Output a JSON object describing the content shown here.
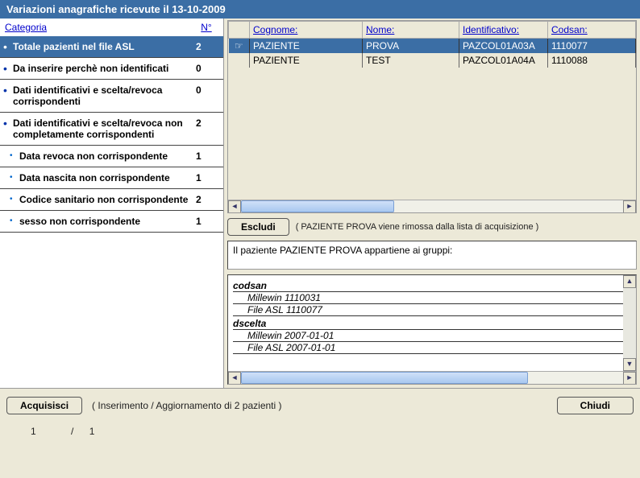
{
  "title": "Variazioni anagrafiche ricevute il 13-10-2009",
  "left": {
    "header_cat": "Categoria",
    "header_num": "N°",
    "items": [
      {
        "text": "Totale pazienti nel file ASL",
        "num": "2",
        "active": true,
        "sub": false
      },
      {
        "text": "Da inserire perchè non identificati",
        "num": "0",
        "active": false,
        "sub": false
      },
      {
        "text": "Dati identificativi e scelta/revoca corrispondenti",
        "num": "0",
        "active": false,
        "sub": false
      },
      {
        "text": "Dati identificativi e scelta/revoca non completamente corrispondenti",
        "num": "2",
        "active": false,
        "sub": false
      },
      {
        "text": "Data revoca non corrispondente",
        "num": "1",
        "active": false,
        "sub": true
      },
      {
        "text": "Data nascita non corrispondente",
        "num": "1",
        "active": false,
        "sub": true
      },
      {
        "text": "Codice sanitario non corrispondente",
        "num": "2",
        "active": false,
        "sub": true
      },
      {
        "text": "sesso non corrispondente",
        "num": "1",
        "active": false,
        "sub": true
      }
    ]
  },
  "table": {
    "headers": [
      "Cognome:",
      "Nome:",
      "Identificativo:",
      "Codsan:"
    ],
    "rows": [
      {
        "cognome": "PAZIENTE",
        "nome": "PROVA",
        "ident": "PAZCOL01A03A",
        "codsan": "1110077",
        "selected": true
      },
      {
        "cognome": "PAZIENTE",
        "nome": "TEST",
        "ident": "PAZCOL01A04A",
        "codsan": "1110088",
        "selected": false
      }
    ]
  },
  "escludi": {
    "button": "Escludi",
    "note": "( PAZIENTE PROVA viene rimossa dalla lista di acquisizione )"
  },
  "group_text": "Il paziente PAZIENTE PROVA appartiene ai gruppi:",
  "details": {
    "codsan_head": "codsan",
    "codsan_millewin": "Millewin 1110031",
    "codsan_fileasl": "File ASL 1110077",
    "dscelta_head": "dscelta",
    "dscelta_millewin": "Millewin 2007-01-01",
    "dscelta_fileasl": "File ASL 2007-01-01"
  },
  "bottom": {
    "acquisisci": "Acquisisci",
    "note": "( Inserimento / Aggiornamento di 2 pazienti )",
    "chiudi": "Chiudi"
  },
  "pager": {
    "current": "1",
    "sep": "/",
    "total": "1"
  }
}
